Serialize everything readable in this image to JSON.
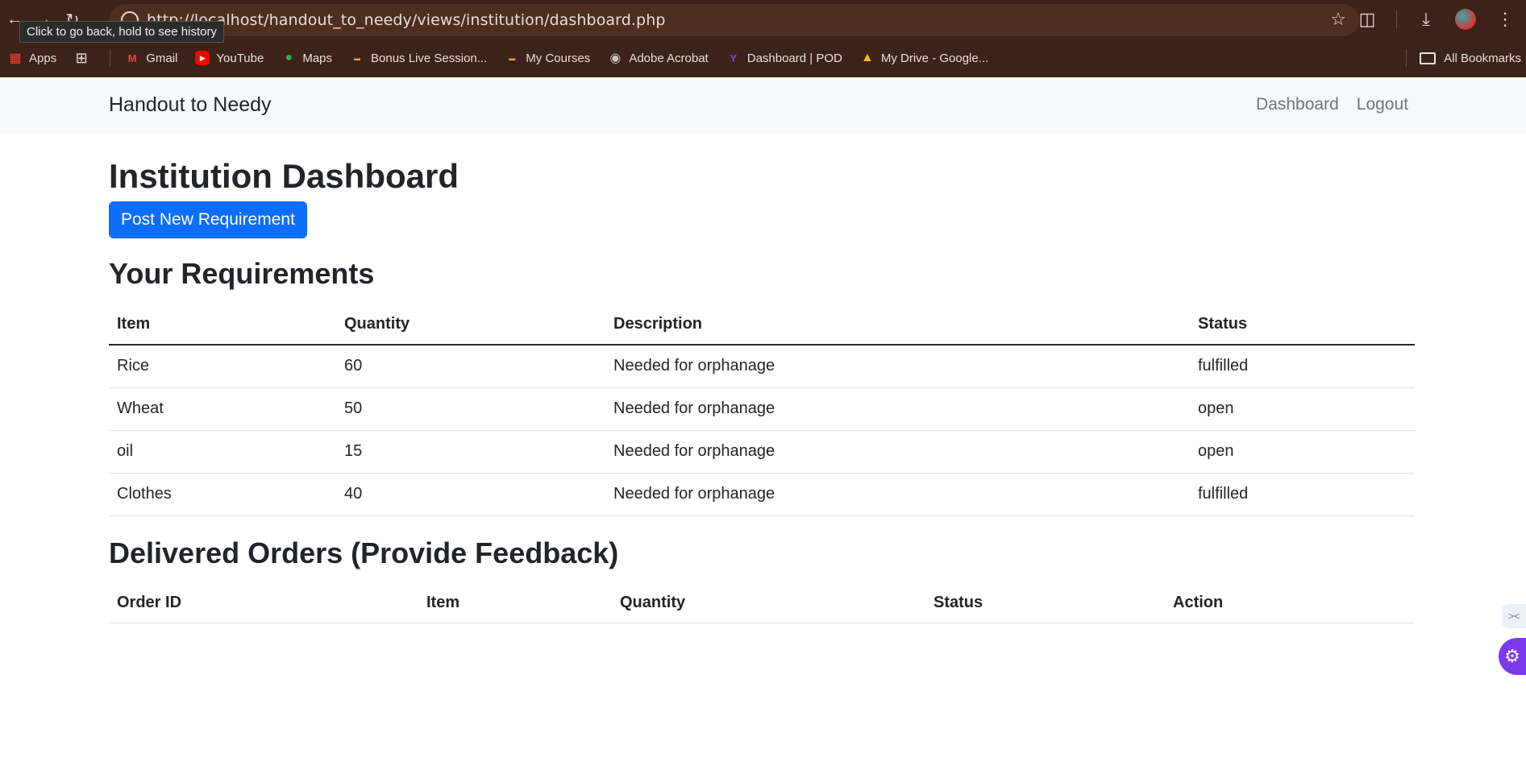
{
  "browser": {
    "url": "http://localhost/handout_to_needy/views/institution/dashboard.php",
    "tooltip": "Click to go back, hold to see history",
    "bookmarks": [
      {
        "label": "Apps",
        "icon": "apps-grid-icon",
        "color": "#e8453c"
      },
      {
        "label": "Gmail",
        "icon": "gmail-icon",
        "color": "#ea4335"
      },
      {
        "label": "YouTube",
        "icon": "youtube-icon",
        "color": "#ff0000"
      },
      {
        "label": "Maps",
        "icon": "maps-pin-icon",
        "color": "#34a853"
      },
      {
        "label": "Bonus Live Session...",
        "icon": "course-icon",
        "color": "#f5a623"
      },
      {
        "label": "My Courses",
        "icon": "course-icon",
        "color": "#f5a623"
      },
      {
        "label": "Adobe Acrobat",
        "icon": "globe-icon",
        "color": "#cfc2bc"
      },
      {
        "label": "Dashboard | POD",
        "icon": "pod-icon",
        "color": "#7b3fe4"
      },
      {
        "label": "My Drive - Google...",
        "icon": "drive-icon",
        "color": "#fbbc04"
      }
    ],
    "all_bookmarks": "All Bookmarks"
  },
  "navbar": {
    "brand": "Handout to Needy",
    "links": [
      "Dashboard",
      "Logout"
    ]
  },
  "page": {
    "title": "Institution Dashboard",
    "post_button": "Post New Requirement",
    "requirements": {
      "title": "Your Requirements",
      "columns": [
        "Item",
        "Quantity",
        "Description",
        "Status"
      ],
      "rows": [
        [
          "Rice",
          "60",
          "Needed for orphanage",
          "fulfilled"
        ],
        [
          "Wheat",
          "50",
          "Needed for orphanage",
          "open"
        ],
        [
          "oil",
          "15",
          "Needed for orphanage",
          "open"
        ],
        [
          "Clothes",
          "40",
          "Needed for orphanage",
          "fulfilled"
        ]
      ]
    },
    "delivered": {
      "title": "Delivered Orders (Provide Feedback)",
      "columns": [
        "Order ID",
        "Item",
        "Quantity",
        "Status",
        "Action"
      ]
    }
  },
  "colors": {
    "primary": "#0d6efd",
    "chrome_bg": "#3c2218",
    "navbar_bg": "#f8f9fa"
  }
}
